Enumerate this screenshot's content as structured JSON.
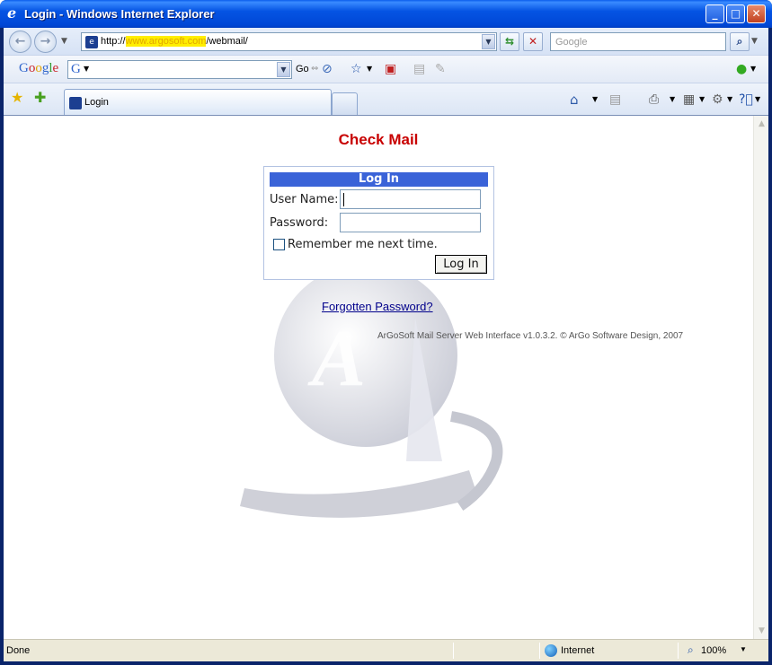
{
  "window": {
    "title": "Login - Windows Internet Explorer",
    "title_icon": "ie-logo-icon"
  },
  "address_bar": {
    "url_prefix": "http://",
    "url_highlighted": "www.argosoft.com",
    "url_suffix": "/webmail/"
  },
  "search_bar": {
    "placeholder": "Google"
  },
  "google_toolbar": {
    "logo": "Google",
    "go_label": "Go"
  },
  "tabs": [
    {
      "label": "Login"
    }
  ],
  "page": {
    "title": "Check Mail",
    "login_box": {
      "header": "Log In",
      "username_label": "User Name:",
      "username_value": "",
      "password_label": "Password:",
      "password_value": "",
      "remember_label": "Remember me next time.",
      "remember_checked": false,
      "submit_label": "Log In"
    },
    "forgot_link": "Forgotten Password?",
    "footer": "ArGoSoft Mail Server Web Interface v1.0.3.2.   © ArGo Software Design, 2007"
  },
  "status_bar": {
    "status": "Done",
    "zone": "Internet",
    "zoom": "100%"
  },
  "colors": {
    "title_red": "#c80000",
    "login_header": "#3a63d8",
    "link": "#00008b"
  }
}
